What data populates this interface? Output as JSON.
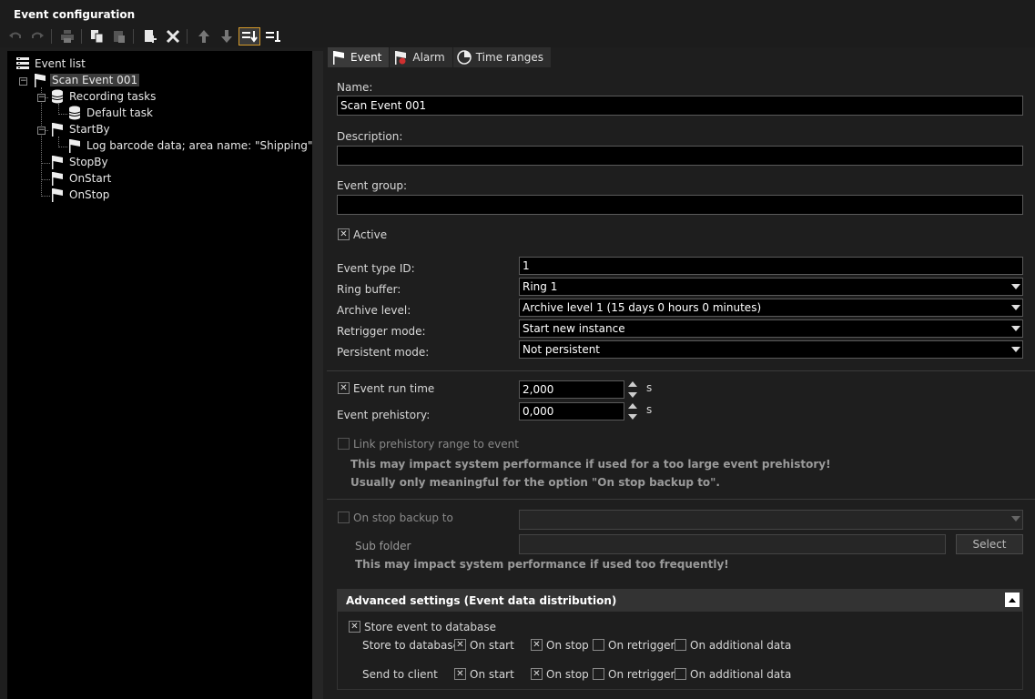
{
  "window": {
    "title": "Event configuration"
  },
  "toolbar": {
    "icons": [
      "undo-icon",
      "redo-icon",
      "print-icon",
      "copy-icon",
      "paste-icon",
      "add-icon",
      "delete-icon",
      "move-up-icon",
      "move-down-icon",
      "sort-icon",
      "sort-alt-icon"
    ]
  },
  "tree": {
    "root": "Event list",
    "event": "Scan Event 001",
    "recording_tasks": "Recording tasks",
    "default_task": "Default task",
    "start_by": "StartBy",
    "log_barcode": "Log barcode data; area name: \"Shipping\";",
    "stop_by": "StopBy",
    "on_start": "OnStart",
    "on_stop": "OnStop"
  },
  "tabs": [
    {
      "label": "Event",
      "icon": "flag-icon"
    },
    {
      "label": "Alarm",
      "icon": "alarm-icon"
    },
    {
      "label": "Time ranges",
      "icon": "clock-icon"
    }
  ],
  "form": {
    "name_label": "Name:",
    "name_value": "Scan Event 001",
    "description_label": "Description:",
    "description_value": "",
    "event_group_label": "Event group:",
    "event_group_value": "",
    "active_label": "Active",
    "active_checked": true,
    "event_type_id_label": "Event type ID:",
    "event_type_id_value": "1",
    "ring_buffer_label": "Ring buffer:",
    "ring_buffer_value": "Ring 1",
    "archive_level_label": "Archive level:",
    "archive_level_value": "Archive level 1 (15 days 0 hours 0 minutes)",
    "retrigger_mode_label": "Retrigger mode:",
    "retrigger_mode_value": "Start new instance",
    "persistent_mode_label": "Persistent mode:",
    "persistent_mode_value": "Not persistent",
    "event_run_time_label": "Event run time",
    "event_run_time_value": "2,000",
    "event_prehistory_label": "Event prehistory:",
    "event_prehistory_value": "0,000",
    "unit_s": "s",
    "link_prehistory_label": "Link prehistory range to event",
    "warning_prehistory": "This may impact system performance if used for a too large event prehistory!",
    "warning_meaningful": "Usually only meaningful for the option \"On stop backup to\".",
    "on_stop_backup_label": "On stop backup to",
    "sub_folder_label": "Sub folder",
    "select_button": "Select",
    "warning_frequently": "This may impact system performance if used too frequently!"
  },
  "advanced": {
    "header": "Advanced settings (Event data distribution)",
    "store_event_label": "Store event to database",
    "store_to_db_label": "Store to database",
    "send_to_client_label": "Send to client",
    "on_start": "On start",
    "on_stop": "On stop",
    "on_retrigger": "On retrigger",
    "on_additional_data": "On additional data"
  }
}
